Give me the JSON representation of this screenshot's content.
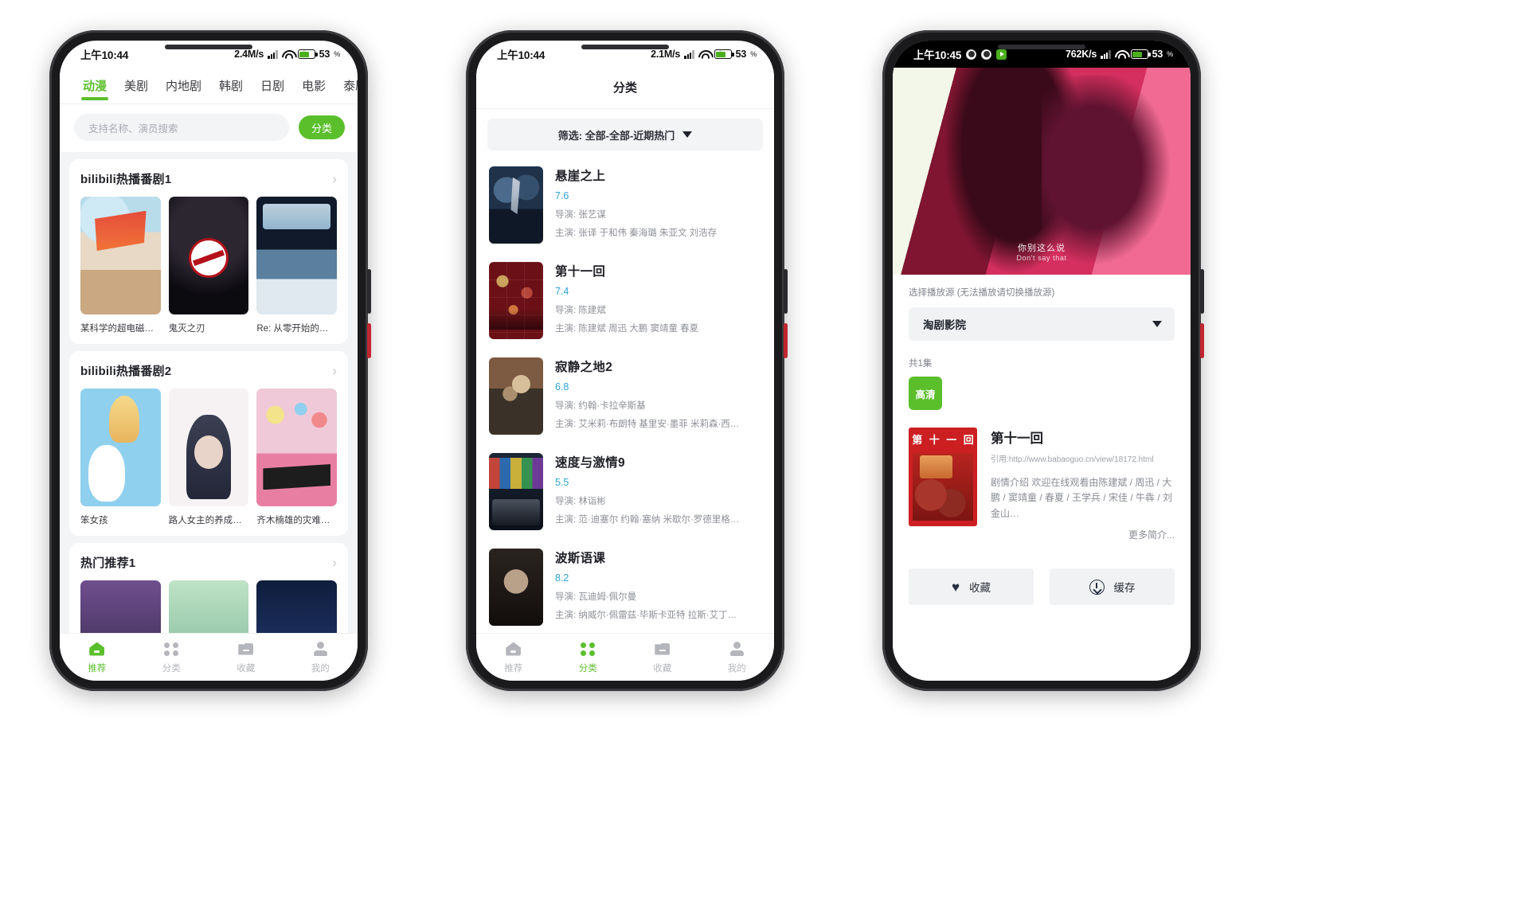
{
  "phone1": {
    "status": {
      "time": "上午10:44",
      "speed": "2.4M/s",
      "battery": "53",
      "pct_sym": "%"
    },
    "tabs": [
      {
        "label": "动漫",
        "active": true
      },
      {
        "label": "美剧",
        "active": false
      },
      {
        "label": "内地剧",
        "active": false
      },
      {
        "label": "韩剧",
        "active": false
      },
      {
        "label": "日剧",
        "active": false
      },
      {
        "label": "电影",
        "active": false
      },
      {
        "label": "泰剧",
        "active": false
      }
    ],
    "search": {
      "placeholder": "支持名称、演员搜索",
      "button": "分类"
    },
    "sections": [
      {
        "title": "bilibili热播番剧1",
        "items": [
          {
            "name": "某科学的超电磁…"
          },
          {
            "name": "鬼灭之刃"
          },
          {
            "name": "Re: 从零开始的…"
          }
        ]
      },
      {
        "title": "bilibili热播番剧2",
        "items": [
          {
            "name": "笨女孩"
          },
          {
            "name": "路人女主的养成…"
          },
          {
            "name": "齐木楠雄的灾难…"
          }
        ]
      },
      {
        "title": "热门推荐1",
        "items": [
          {
            "name": ""
          },
          {
            "name": ""
          },
          {
            "name": ""
          }
        ]
      }
    ],
    "nav": [
      {
        "label": "推荐",
        "icon": "home-icon",
        "active": true
      },
      {
        "label": "分类",
        "icon": "grid-icon",
        "active": false
      },
      {
        "label": "收藏",
        "icon": "folder-icon",
        "active": false
      },
      {
        "label": "我的",
        "icon": "user-icon",
        "active": false
      }
    ]
  },
  "phone2": {
    "status": {
      "time": "上午10:44",
      "speed": "2.1M/s",
      "battery": "53",
      "pct_sym": "%"
    },
    "title": "分类",
    "filter": "筛选: 全部-全部-近期热门",
    "movies": [
      {
        "title": "悬崖之上",
        "score": "7.6",
        "director": "导演: 张艺谋",
        "cast": "主演: 张译 于和伟 秦海璐 朱亚文 刘浩存"
      },
      {
        "title": "第十一回",
        "score": "7.4",
        "director": "导演: 陈建斌",
        "cast": "主演: 陈建斌 周迅 大鹏 窦靖童 春夏"
      },
      {
        "title": "寂静之地2",
        "score": "6.8",
        "director": "导演: 约翰·卡拉辛斯基",
        "cast": "主演: 艾米莉·布朗特 基里安·墨菲 米莉森·西…"
      },
      {
        "title": "速度与激情9",
        "score": "5.5",
        "director": "导演: 林诣彬",
        "cast": "主演: 范·迪塞尔 约翰·塞纳 米歇尔·罗德里格…"
      },
      {
        "title": "波斯语课",
        "score": "8.2",
        "director": "导演: 瓦迪姆·佩尔曼",
        "cast": "主演: 纳威尔·佩雷兹·毕斯卡亚特 拉斯·艾丁…"
      }
    ],
    "nav": [
      {
        "label": "推荐",
        "icon": "home-icon",
        "active": false
      },
      {
        "label": "分类",
        "icon": "grid-icon",
        "active": true
      },
      {
        "label": "收藏",
        "icon": "folder-icon",
        "active": false
      },
      {
        "label": "我的",
        "icon": "user-icon",
        "active": false
      }
    ]
  },
  "phone3": {
    "status": {
      "time": "上午10:45",
      "speed": "762K/s",
      "battery": "53",
      "pct_sym": "%"
    },
    "subtitle_cn": "你别这么说",
    "subtitle_en": "Don't say that",
    "source_label": "选择播放源 (无法播放请切换播放源)",
    "source_value": "淘剧影院",
    "episodes_count": "共1集",
    "episode_chip": "高清",
    "detail": {
      "title": "第十一回",
      "source_url": "引用:http://www.babaoguo.cn/view/18172.html",
      "desc": "剧情介绍 欢迎在线观看由陈建斌 / 周迅 / 大鹏 / 窦靖童 / 春夏 / 王学兵 / 宋佳 / 牛犇 / 刘金山…",
      "more": "更多简介...",
      "poster_chars": [
        "第",
        "十",
        "一",
        "回"
      ]
    },
    "actions": [
      {
        "label": "收藏",
        "icon": "heart-icon"
      },
      {
        "label": "缓存",
        "icon": "download-icon"
      }
    ]
  },
  "colors": {
    "accent_green": "#5bbf2c",
    "score_blue": "#2fa3d8",
    "muted": "#8d9096",
    "bg_gray": "#f2f4f6"
  }
}
